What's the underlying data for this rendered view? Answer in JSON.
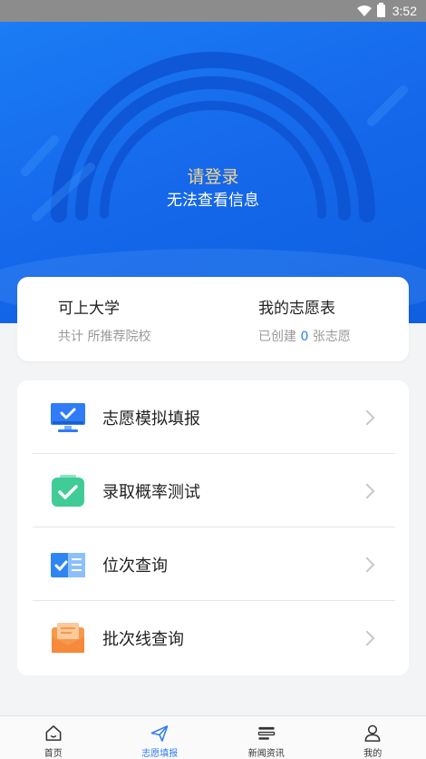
{
  "status_bar": {
    "time": "3:52"
  },
  "hero": {
    "title": "请登录",
    "subtitle": "无法查看信息"
  },
  "stats": {
    "left": {
      "title": "可上大学",
      "prefix": "共计",
      "suffix": "所推荐院校"
    },
    "right": {
      "title": "我的志愿表",
      "prefix": "已创建",
      "count": "0",
      "suffix": "张志愿"
    }
  },
  "menu": [
    {
      "label": "志愿模拟填报",
      "icon": "monitor-check-icon"
    },
    {
      "label": "录取概率测试",
      "icon": "clipboard-check-icon"
    },
    {
      "label": "位次查询",
      "icon": "ranking-card-icon"
    },
    {
      "label": "批次线查询",
      "icon": "envelope-icon"
    }
  ],
  "tabs": [
    {
      "label": "首页",
      "icon": "home-icon",
      "active": false
    },
    {
      "label": "志愿填报",
      "icon": "paper-plane-icon",
      "active": true
    },
    {
      "label": "新闻资讯",
      "icon": "news-list-icon",
      "active": false
    },
    {
      "label": "我的",
      "icon": "user-icon",
      "active": false
    }
  ],
  "colors": {
    "accent": "#2e7cf3",
    "hero_title": "#f6d690",
    "hero_bg": "#1568ea"
  }
}
